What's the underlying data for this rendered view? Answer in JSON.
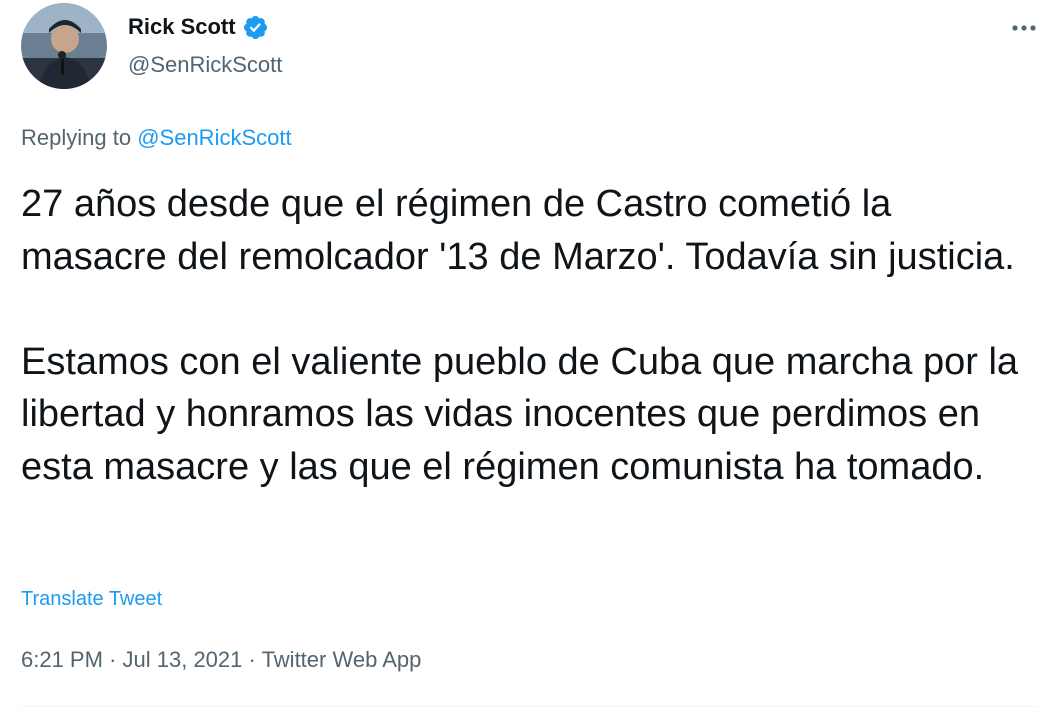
{
  "author": {
    "name": "Rick Scott",
    "handle": "@SenRickScott",
    "verified": true
  },
  "reply": {
    "prefix": "Replying to",
    "to": "@SenRickScott"
  },
  "tweet": {
    "paragraph_1": "27 años desde que el régimen de Castro cometió la masacre del remolcador '13 de Marzo'. Todavía sin justicia.",
    "paragraph_2": "Estamos con el valiente pueblo de Cuba que marcha por la libertad y honramos las vidas inocentes que perdimos en esta masacre y las que el régimen comunista ha tomado."
  },
  "translate_label": "Translate Tweet",
  "meta": {
    "time": "6:21 PM",
    "separator": "·",
    "date": "Jul 13, 2021",
    "source": "Twitter Web App"
  },
  "colors": {
    "accent": "#1d9bf0",
    "text": "#0f1419",
    "secondary": "#536471"
  },
  "icons": {
    "verified": "verified-badge-icon",
    "more": "more-dots-icon"
  }
}
